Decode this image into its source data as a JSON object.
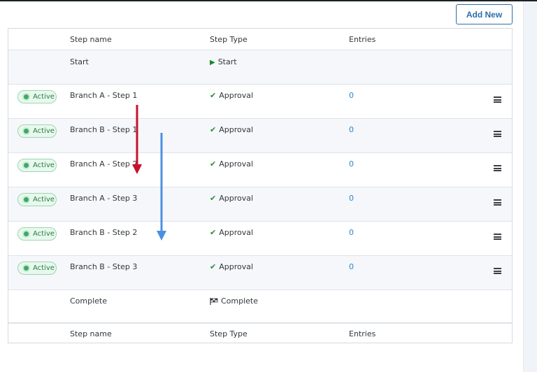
{
  "toolbar": {
    "add_new_label": "Add New"
  },
  "table": {
    "header": {
      "name": "Step name",
      "type": "Step Type",
      "entries": "Entries"
    },
    "footer": {
      "name": "Step name",
      "type": "Step Type",
      "entries": "Entries"
    },
    "start_row": {
      "name": "Start",
      "type": "Start",
      "icon": "play-icon"
    },
    "complete_row": {
      "name": "Complete",
      "type": "Complete",
      "icon": "finish-flag-icon"
    },
    "steps": [
      {
        "status": "Active",
        "name": "Branch A - Step 1",
        "type": "Approval",
        "entries": "0"
      },
      {
        "status": "Active",
        "name": "Branch B - Step 1",
        "type": "Approval",
        "entries": "0"
      },
      {
        "status": "Active",
        "name": "Branch A - Step 2",
        "type": "Approval",
        "entries": "0"
      },
      {
        "status": "Active",
        "name": "Branch A - Step 3",
        "type": "Approval",
        "entries": "0"
      },
      {
        "status": "Active",
        "name": "Branch B - Step 2",
        "type": "Approval",
        "entries": "0"
      },
      {
        "status": "Active",
        "name": "Branch B - Step 3",
        "type": "Approval",
        "entries": "0"
      }
    ]
  },
  "annotations": {
    "red_arrow_color": "#c8102e",
    "blue_arrow_color": "#4a90e2"
  }
}
